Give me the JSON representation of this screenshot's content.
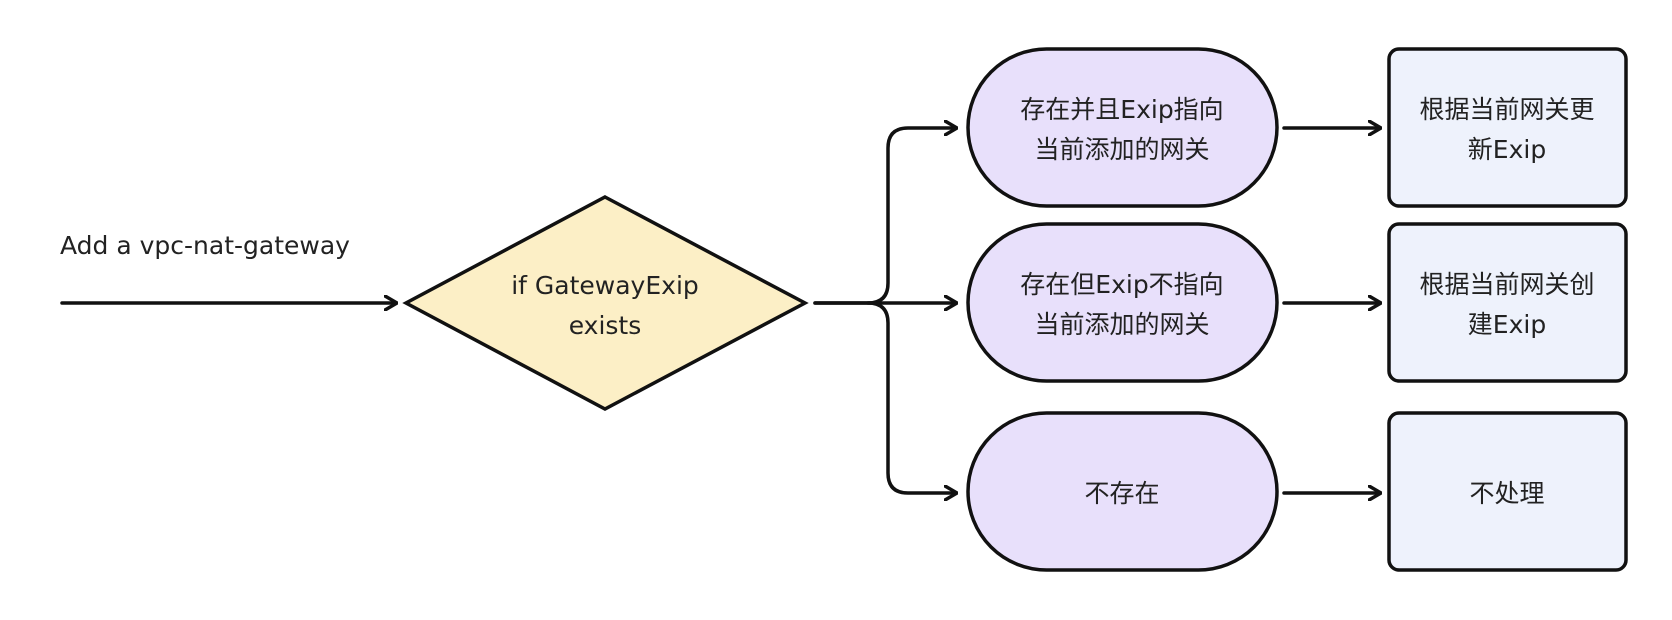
{
  "start_label": "Add a vpc-nat-gateway",
  "decision": {
    "line1": "if GatewayExip",
    "line2": "exists"
  },
  "branches": [
    {
      "condition": {
        "line1": "存在并且Exip指向",
        "line2": "当前添加的网关"
      },
      "action": {
        "line1": "根据当前网关更",
        "line2": "新Exip"
      }
    },
    {
      "condition": {
        "line1": "存在但Exip不指向",
        "line2": "当前添加的网关"
      },
      "action": {
        "line1": "根据当前网关创",
        "line2": "建Exip"
      }
    },
    {
      "condition": {
        "line1": "不存在"
      },
      "action": {
        "line1": "不处理"
      }
    }
  ],
  "colors": {
    "decision_fill": "#fcefc6",
    "condition_fill": "#e8e0fb",
    "action_fill": "#eef2fc",
    "stroke": "#111111"
  }
}
